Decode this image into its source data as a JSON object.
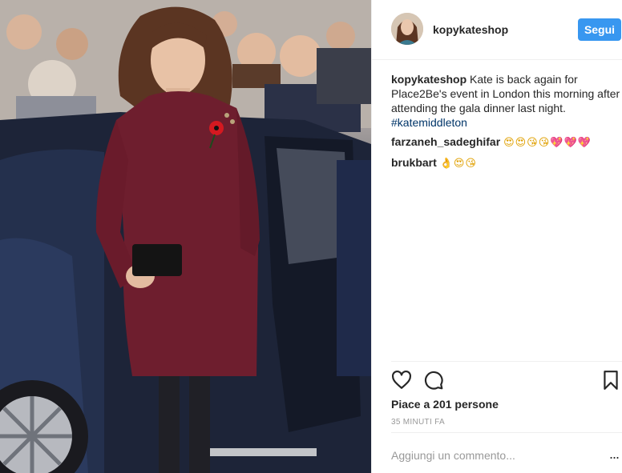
{
  "post": {
    "username": "kopykateshop",
    "follow_label": "Segui",
    "caption": {
      "user": "kopykateshop",
      "text": "Kate is back again for Place2Be's event in London this morning after attending the gala dinner last night.",
      "hashtag": "#katemiddleton"
    },
    "comments": [
      {
        "user": "farzaneh_sadeghifar",
        "emoji": "😍😍😘😘💖💖💖"
      },
      {
        "user": "brukbart",
        "emoji": "👌😍😘"
      }
    ],
    "likes_text": "Piace a 201 persone",
    "time_text": "35 MINUTI FA",
    "comment_placeholder": "Aggiungi un commento...",
    "more_label": "..."
  },
  "icons": {
    "like": "heart-icon",
    "comment": "comment-icon",
    "save": "bookmark-icon",
    "more": "more-icon"
  },
  "colors": {
    "follow_button": "#3897f0",
    "hashtag": "#003569",
    "muted": "#999999",
    "dress": "#6e1e2e"
  }
}
